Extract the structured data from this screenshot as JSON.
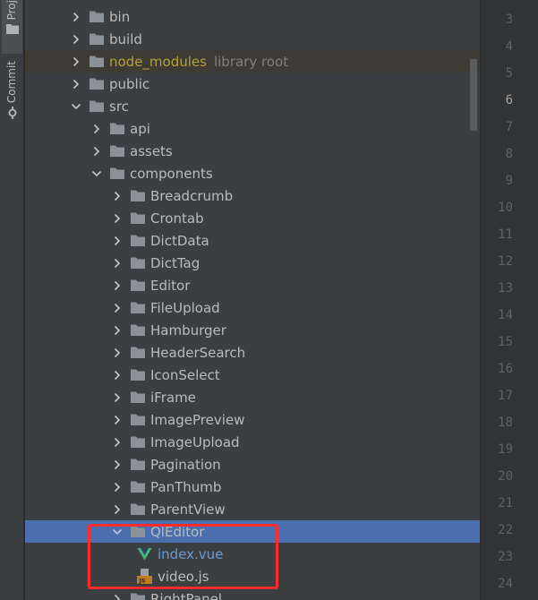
{
  "tool_window_tabs": [
    {
      "label": "Proj",
      "icon": "folder-icon"
    },
    {
      "label": "Commit",
      "icon": "commit-icon"
    }
  ],
  "tree": [
    {
      "label": "bin",
      "kind": "folder",
      "depth": 0,
      "expanded": false
    },
    {
      "label": "build",
      "kind": "folder",
      "depth": 0,
      "expanded": false
    },
    {
      "label": "node_modules",
      "kind": "folder",
      "depth": 0,
      "expanded": false,
      "excluded": true,
      "hint": "library root"
    },
    {
      "label": "public",
      "kind": "folder",
      "depth": 0,
      "expanded": false
    },
    {
      "label": "src",
      "kind": "folder",
      "depth": 0,
      "expanded": true
    },
    {
      "label": "api",
      "kind": "folder",
      "depth": 1,
      "expanded": false
    },
    {
      "label": "assets",
      "kind": "folder",
      "depth": 1,
      "expanded": false
    },
    {
      "label": "components",
      "kind": "folder",
      "depth": 1,
      "expanded": true
    },
    {
      "label": "Breadcrumb",
      "kind": "folder",
      "depth": 2,
      "expanded": false
    },
    {
      "label": "Crontab",
      "kind": "folder",
      "depth": 2,
      "expanded": false
    },
    {
      "label": "DictData",
      "kind": "folder",
      "depth": 2,
      "expanded": false
    },
    {
      "label": "DictTag",
      "kind": "folder",
      "depth": 2,
      "expanded": false
    },
    {
      "label": "Editor",
      "kind": "folder",
      "depth": 2,
      "expanded": false
    },
    {
      "label": "FileUpload",
      "kind": "folder",
      "depth": 2,
      "expanded": false
    },
    {
      "label": "Hamburger",
      "kind": "folder",
      "depth": 2,
      "expanded": false
    },
    {
      "label": "HeaderSearch",
      "kind": "folder",
      "depth": 2,
      "expanded": false
    },
    {
      "label": "IconSelect",
      "kind": "folder",
      "depth": 2,
      "expanded": false
    },
    {
      "label": "iFrame",
      "kind": "folder",
      "depth": 2,
      "expanded": false
    },
    {
      "label": "ImagePreview",
      "kind": "folder",
      "depth": 2,
      "expanded": false
    },
    {
      "label": "ImageUpload",
      "kind": "folder",
      "depth": 2,
      "expanded": false
    },
    {
      "label": "Pagination",
      "kind": "folder",
      "depth": 2,
      "expanded": false
    },
    {
      "label": "PanThumb",
      "kind": "folder",
      "depth": 2,
      "expanded": false
    },
    {
      "label": "ParentView",
      "kind": "folder",
      "depth": 2,
      "expanded": false
    },
    {
      "label": "QlEditor",
      "kind": "folder",
      "depth": 2,
      "expanded": true,
      "selected": true
    },
    {
      "label": "index.vue",
      "kind": "vue",
      "depth": 3
    },
    {
      "label": "video.js",
      "kind": "js",
      "depth": 3
    },
    {
      "label": "RightPanel",
      "kind": "folder",
      "depth": 2,
      "expanded": false
    }
  ],
  "line_numbers": [
    "3",
    "4",
    "5",
    "6",
    "7",
    "8",
    "9",
    "10",
    "11",
    "12",
    "13",
    "14",
    "15",
    "16",
    "17",
    "18",
    "19",
    "20",
    "21",
    "22",
    "23",
    "24"
  ],
  "current_line": "6",
  "colors": {
    "selection": "#4b6eaf",
    "annotation": "#ff2b2b",
    "excluded_text": "#b5a13a",
    "vue_text": "#6b9bd1"
  }
}
